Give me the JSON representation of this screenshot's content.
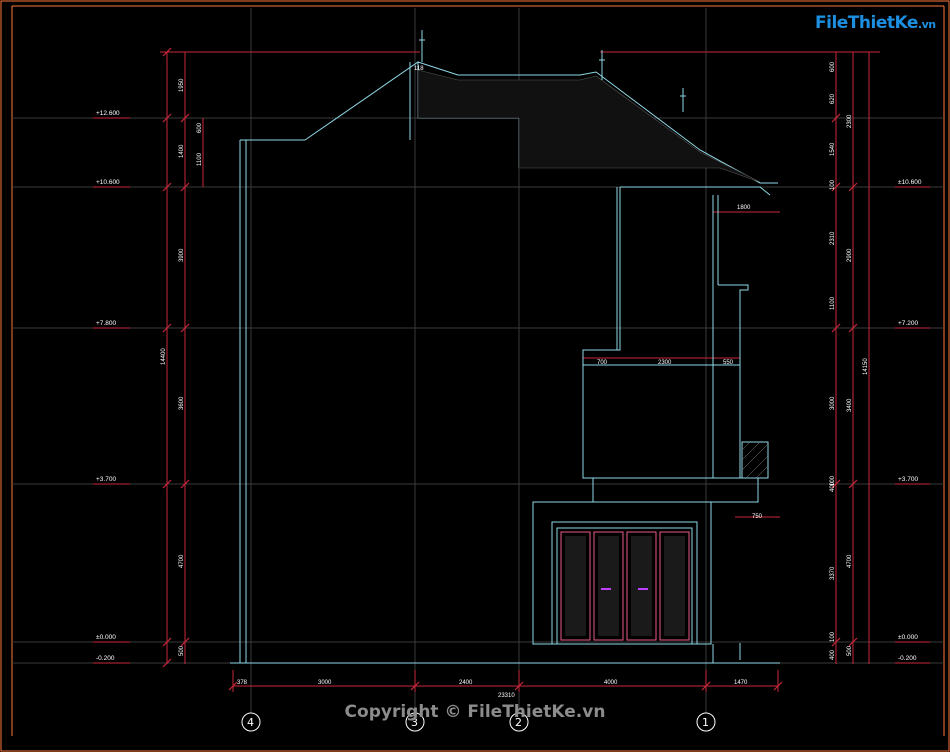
{
  "watermark": {
    "logo_main": "File",
    "logo_rest": "ThietKe",
    "logo_suffix": ".vn",
    "copyright": "Copyright © FileThietKe.vn"
  },
  "levels": {
    "left": [
      "+12.600",
      "+10.600",
      "+7.800",
      "+3.700",
      "±0.000",
      "-0.200"
    ],
    "right": [
      "±10.600",
      "+7.200",
      "+3.700",
      "±0.000",
      "-0.200"
    ]
  },
  "dims": {
    "left_outer": [
      "1950",
      "1400",
      "3900",
      "3600",
      "4700",
      "500"
    ],
    "left_inner": [
      "600",
      "1100"
    ],
    "left_total": "14400",
    "right_outer": [
      "2300",
      "2900",
      "3400",
      "4700",
      "500"
    ],
    "right_inner": [
      "600",
      "620",
      "1540",
      "100",
      "2310",
      "1100",
      "3000",
      "400",
      "100",
      "3370",
      "100",
      "400"
    ],
    "right_total": "14150",
    "bottom": [
      "378",
      "3000",
      "2400",
      "4000",
      "1470"
    ],
    "bottom_total": "23310",
    "mid": [
      "700",
      "2300",
      "550",
      "750",
      "1800"
    ],
    "roof": [
      "118"
    ]
  },
  "axes": [
    "4",
    "3",
    "2",
    "1"
  ]
}
